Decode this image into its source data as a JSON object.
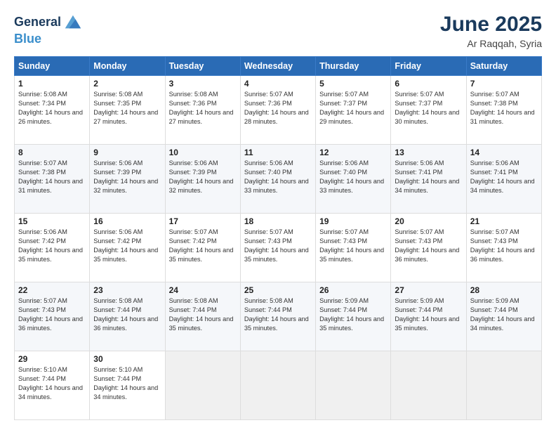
{
  "logo": {
    "line1": "General",
    "line2": "Blue"
  },
  "title": "June 2025",
  "location": "Ar Raqqah, Syria",
  "days_header": [
    "Sunday",
    "Monday",
    "Tuesday",
    "Wednesday",
    "Thursday",
    "Friday",
    "Saturday"
  ],
  "weeks": [
    [
      {
        "day": "1",
        "sunrise": "5:08 AM",
        "sunset": "7:34 PM",
        "daylight": "14 hours and 26 minutes."
      },
      {
        "day": "2",
        "sunrise": "5:08 AM",
        "sunset": "7:35 PM",
        "daylight": "14 hours and 27 minutes."
      },
      {
        "day": "3",
        "sunrise": "5:08 AM",
        "sunset": "7:36 PM",
        "daylight": "14 hours and 27 minutes."
      },
      {
        "day": "4",
        "sunrise": "5:07 AM",
        "sunset": "7:36 PM",
        "daylight": "14 hours and 28 minutes."
      },
      {
        "day": "5",
        "sunrise": "5:07 AM",
        "sunset": "7:37 PM",
        "daylight": "14 hours and 29 minutes."
      },
      {
        "day": "6",
        "sunrise": "5:07 AM",
        "sunset": "7:37 PM",
        "daylight": "14 hours and 30 minutes."
      },
      {
        "day": "7",
        "sunrise": "5:07 AM",
        "sunset": "7:38 PM",
        "daylight": "14 hours and 31 minutes."
      }
    ],
    [
      {
        "day": "8",
        "sunrise": "5:07 AM",
        "sunset": "7:38 PM",
        "daylight": "14 hours and 31 minutes."
      },
      {
        "day": "9",
        "sunrise": "5:06 AM",
        "sunset": "7:39 PM",
        "daylight": "14 hours and 32 minutes."
      },
      {
        "day": "10",
        "sunrise": "5:06 AM",
        "sunset": "7:39 PM",
        "daylight": "14 hours and 32 minutes."
      },
      {
        "day": "11",
        "sunrise": "5:06 AM",
        "sunset": "7:40 PM",
        "daylight": "14 hours and 33 minutes."
      },
      {
        "day": "12",
        "sunrise": "5:06 AM",
        "sunset": "7:40 PM",
        "daylight": "14 hours and 33 minutes."
      },
      {
        "day": "13",
        "sunrise": "5:06 AM",
        "sunset": "7:41 PM",
        "daylight": "14 hours and 34 minutes."
      },
      {
        "day": "14",
        "sunrise": "5:06 AM",
        "sunset": "7:41 PM",
        "daylight": "14 hours and 34 minutes."
      }
    ],
    [
      {
        "day": "15",
        "sunrise": "5:06 AM",
        "sunset": "7:42 PM",
        "daylight": "14 hours and 35 minutes."
      },
      {
        "day": "16",
        "sunrise": "5:06 AM",
        "sunset": "7:42 PM",
        "daylight": "14 hours and 35 minutes."
      },
      {
        "day": "17",
        "sunrise": "5:07 AM",
        "sunset": "7:42 PM",
        "daylight": "14 hours and 35 minutes."
      },
      {
        "day": "18",
        "sunrise": "5:07 AM",
        "sunset": "7:43 PM",
        "daylight": "14 hours and 35 minutes."
      },
      {
        "day": "19",
        "sunrise": "5:07 AM",
        "sunset": "7:43 PM",
        "daylight": "14 hours and 35 minutes."
      },
      {
        "day": "20",
        "sunrise": "5:07 AM",
        "sunset": "7:43 PM",
        "daylight": "14 hours and 36 minutes."
      },
      {
        "day": "21",
        "sunrise": "5:07 AM",
        "sunset": "7:43 PM",
        "daylight": "14 hours and 36 minutes."
      }
    ],
    [
      {
        "day": "22",
        "sunrise": "5:07 AM",
        "sunset": "7:43 PM",
        "daylight": "14 hours and 36 minutes."
      },
      {
        "day": "23",
        "sunrise": "5:08 AM",
        "sunset": "7:44 PM",
        "daylight": "14 hours and 36 minutes."
      },
      {
        "day": "24",
        "sunrise": "5:08 AM",
        "sunset": "7:44 PM",
        "daylight": "14 hours and 35 minutes."
      },
      {
        "day": "25",
        "sunrise": "5:08 AM",
        "sunset": "7:44 PM",
        "daylight": "14 hours and 35 minutes."
      },
      {
        "day": "26",
        "sunrise": "5:09 AM",
        "sunset": "7:44 PM",
        "daylight": "14 hours and 35 minutes."
      },
      {
        "day": "27",
        "sunrise": "5:09 AM",
        "sunset": "7:44 PM",
        "daylight": "14 hours and 35 minutes."
      },
      {
        "day": "28",
        "sunrise": "5:09 AM",
        "sunset": "7:44 PM",
        "daylight": "14 hours and 34 minutes."
      }
    ],
    [
      {
        "day": "29",
        "sunrise": "5:10 AM",
        "sunset": "7:44 PM",
        "daylight": "14 hours and 34 minutes."
      },
      {
        "day": "30",
        "sunrise": "5:10 AM",
        "sunset": "7:44 PM",
        "daylight": "14 hours and 34 minutes."
      },
      null,
      null,
      null,
      null,
      null
    ]
  ]
}
